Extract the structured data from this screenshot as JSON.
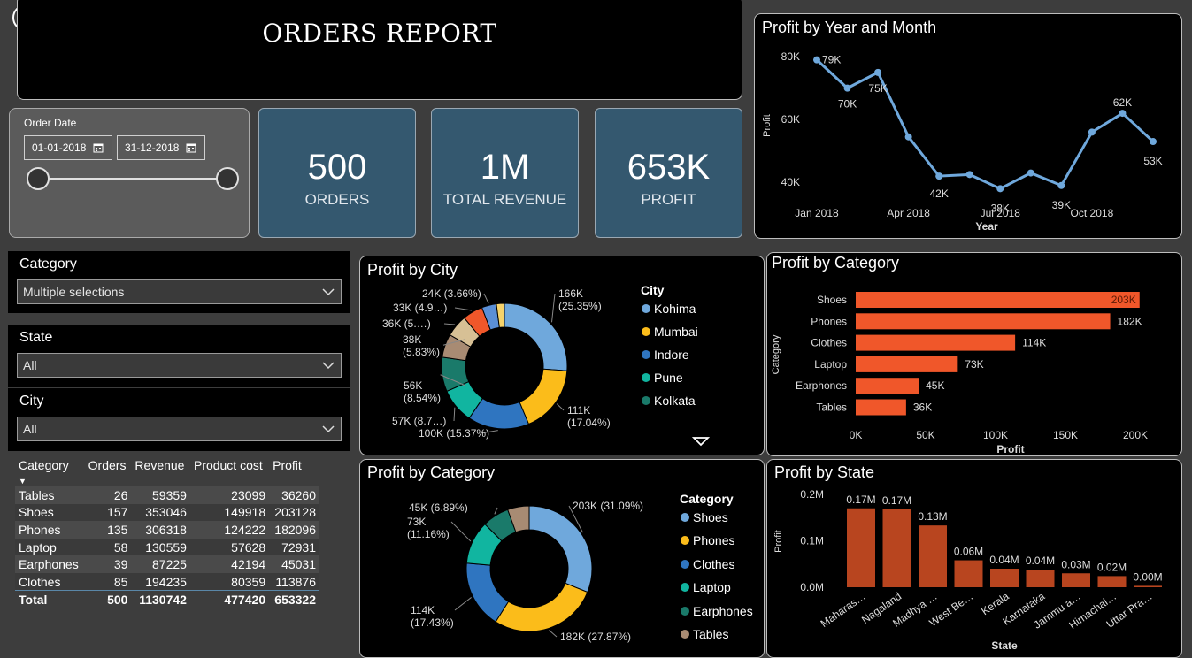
{
  "header": {
    "title": "ORDERS REPORT"
  },
  "date_filter": {
    "label": "Order Date",
    "start": "01-01-2018",
    "end": "31-12-2018"
  },
  "kpis": [
    {
      "value": "500",
      "label": "ORDERS"
    },
    {
      "value": "1M",
      "label": "TOTAL REVENUE"
    },
    {
      "value": "653K",
      "label": "PROFIT"
    }
  ],
  "slicers": {
    "category": {
      "label": "Category",
      "value": "Multiple selections"
    },
    "state": {
      "label": "State",
      "value": "All"
    },
    "city": {
      "label": "City",
      "value": "All"
    }
  },
  "table": {
    "headers": [
      "Category",
      "Orders",
      "Revenue",
      "Product cost",
      "Profit"
    ],
    "rows": [
      [
        "Tables",
        "26",
        "59359",
        "23099",
        "36260"
      ],
      [
        "Shoes",
        "157",
        "353046",
        "149918",
        "203128"
      ],
      [
        "Phones",
        "135",
        "306318",
        "124222",
        "182096"
      ],
      [
        "Laptop",
        "58",
        "130559",
        "57628",
        "72931"
      ],
      [
        "Earphones",
        "39",
        "87225",
        "42194",
        "45031"
      ],
      [
        "Clothes",
        "85",
        "194235",
        "80359",
        "113876"
      ]
    ],
    "total": [
      "Total",
      "500",
      "1130742",
      "477420",
      "653322"
    ]
  },
  "colors": {
    "blue": "#6fa8dc",
    "orange_bar": "#f0572a",
    "state_bar": "#b8451f",
    "kpi_bg": "#34586f"
  },
  "chart_data": [
    {
      "id": "profit_by_month",
      "type": "line",
      "title": "Profit by Year and Month",
      "xlabel": "Year",
      "ylabel": "Profit",
      "x_ticks": [
        "Jan 2018",
        "Apr 2018",
        "Jul 2018",
        "Oct 2018"
      ],
      "y_ticks": [
        "40K",
        "60K",
        "80K"
      ],
      "ylim": [
        35000,
        82000
      ],
      "x": [
        "Jan 2018",
        "Feb 2018",
        "Mar 2018",
        "Apr 2018",
        "May 2018",
        "Jun 2018",
        "Jul 2018",
        "Aug 2018",
        "Sep 2018",
        "Oct 2018",
        "Nov 2018",
        "Dec 2018"
      ],
      "values": [
        79000,
        70000,
        75000,
        54500,
        42000,
        42500,
        38000,
        43000,
        39000,
        56000,
        62000,
        53000
      ],
      "labels": [
        "79K",
        "70K",
        "75K",
        "",
        "42K",
        "",
        "38K",
        "",
        "39K",
        "",
        "62K",
        "53K"
      ]
    },
    {
      "id": "profit_by_city",
      "type": "pie",
      "title": "Profit by City",
      "legend_title": "City",
      "legend": [
        "Kohima",
        "Mumbai",
        "Indore",
        "Pune",
        "Kolkata"
      ],
      "values": [
        166,
        111,
        100,
        57,
        56,
        38,
        36,
        33,
        24
      ],
      "colors": [
        "#6fa8dc",
        "#fbbc1a",
        "#2f75c0",
        "#11b5a0",
        "#1a7a6a",
        "#a88b73",
        "#d7c095",
        "#f0572a",
        "#5b8fd6"
      ],
      "labels": [
        "166K\n(25.35%)",
        "111K\n(17.04%)",
        "100K (15.37%)",
        "57K (8.7…)",
        "56K\n(8.54%)",
        "38K\n(5.83%)",
        "36K (5.…)",
        "33K (4.9…)",
        "24K (3.66%)"
      ],
      "extra_color": "#f5d36b"
    },
    {
      "id": "profit_by_category_bar",
      "type": "bar",
      "orientation": "horizontal",
      "title": "Profit by Category",
      "xlabel": "Profit",
      "ylabel": "Category",
      "categories": [
        "Shoes",
        "Phones",
        "Clothes",
        "Laptop",
        "Earphones",
        "Tables"
      ],
      "values": [
        203,
        182,
        114,
        73,
        45,
        36
      ],
      "labels": [
        "203K",
        "182K",
        "114K",
        "73K",
        "45K",
        "36K"
      ],
      "x_ticks": [
        "0K",
        "50K",
        "100K",
        "150K",
        "200K"
      ],
      "xlim": [
        0,
        200
      ]
    },
    {
      "id": "profit_by_category_donut",
      "type": "pie",
      "title": "Profit by Category",
      "legend_title": "Category",
      "legend": [
        "Shoes",
        "Phones",
        "Clothes",
        "Laptop",
        "Earphones",
        "Tables"
      ],
      "values": [
        31.09,
        27.87,
        17.43,
        11.16,
        6.89,
        5.56
      ],
      "colors": [
        "#6fa8dc",
        "#fbbc1a",
        "#2f75c0",
        "#11b5a0",
        "#1a7a6a",
        "#a88b73"
      ],
      "labels": [
        "203K (31.09%)",
        "182K (27.87%)",
        "114K\n(17.43%)",
        "73K\n(11.16%)",
        "45K (6.89%)",
        ""
      ]
    },
    {
      "id": "profit_by_state",
      "type": "bar",
      "title": "Profit by State",
      "xlabel": "State",
      "ylabel": "Profit",
      "categories": [
        "Maharas…",
        "Nagaland",
        "Madhya …",
        "West Be…",
        "Kerala",
        "Karnataka",
        "Jammu a…",
        "Himachal…",
        "Uttar Pra…"
      ],
      "values": [
        0.17,
        0.168,
        0.133,
        0.058,
        0.04,
        0.038,
        0.03,
        0.024,
        0.003
      ],
      "labels": [
        "0.17M",
        "0.17M",
        "0.13M",
        "0.06M",
        "0.04M",
        "0.04M",
        "0.03M",
        "0.02M",
        "0.00M"
      ],
      "y_ticks": [
        "0.0M",
        "0.1M",
        "0.2M"
      ],
      "ylim": [
        0,
        0.2
      ]
    }
  ]
}
